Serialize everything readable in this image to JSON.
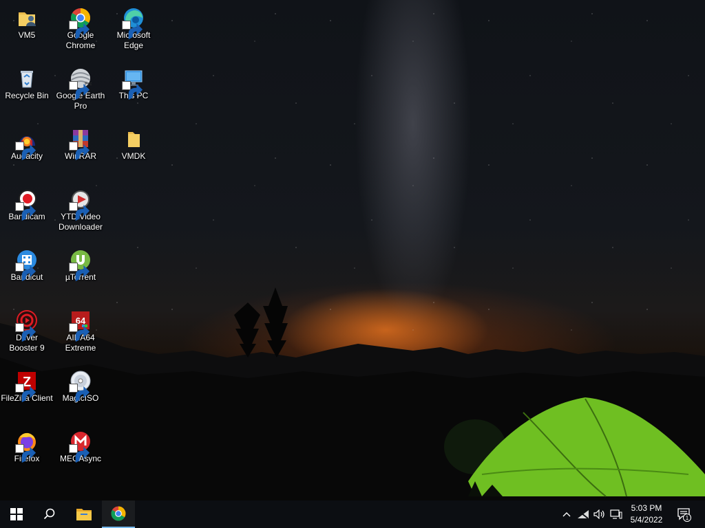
{
  "desktop": {
    "icons": [
      {
        "label": "VM5",
        "icon": "user-folder-icon"
      },
      {
        "label": "Google Chrome",
        "icon": "chrome-icon"
      },
      {
        "label": "Microsoft Edge",
        "icon": "edge-icon"
      },
      {
        "label": "Recycle Bin",
        "icon": "recycle-bin-icon"
      },
      {
        "label": "Google Earth Pro",
        "icon": "google-earth-icon"
      },
      {
        "label": "This PC",
        "icon": "this-pc-icon"
      },
      {
        "label": "Audacity",
        "icon": "audacity-icon"
      },
      {
        "label": "WinRAR",
        "icon": "winrar-icon"
      },
      {
        "label": "VMDK",
        "icon": "folder-icon"
      },
      {
        "label": "Bandicam",
        "icon": "bandicam-icon"
      },
      {
        "label": "YTD Video Downloader",
        "icon": "ytd-icon"
      },
      {
        "label": "Bandicut",
        "icon": "bandicut-icon"
      },
      {
        "label": "µTorrent",
        "icon": "utorrent-icon"
      },
      {
        "label": "Driver Booster 9",
        "icon": "driver-booster-icon"
      },
      {
        "label": "AIDA64 Extreme",
        "icon": "aida64-icon"
      },
      {
        "label": "FileZilla Client",
        "icon": "filezilla-icon"
      },
      {
        "label": "MagicISO",
        "icon": "magiciso-icon"
      },
      {
        "label": "Firefox",
        "icon": "firefox-icon"
      },
      {
        "label": "MEGAsync",
        "icon": "megasync-icon"
      }
    ]
  },
  "taskbar": {
    "start": "windows-start-icon",
    "search": "search-icon",
    "pinned": [
      {
        "name": "File Explorer",
        "icon": "file-explorer-icon"
      },
      {
        "name": "Google Chrome",
        "icon": "chrome-icon",
        "active": true
      }
    ],
    "tray": {
      "icons": [
        "chevron-up-icon",
        "network-disconnected-icon",
        "volume-icon",
        "desktop-pc-icon"
      ],
      "time": "5:03 PM",
      "date": "5/4/2022",
      "notification_count": "1"
    }
  },
  "colors": {
    "taskbar": "#0c0e12",
    "active_indicator": "#76b9ed",
    "tent": "#7ed321"
  }
}
